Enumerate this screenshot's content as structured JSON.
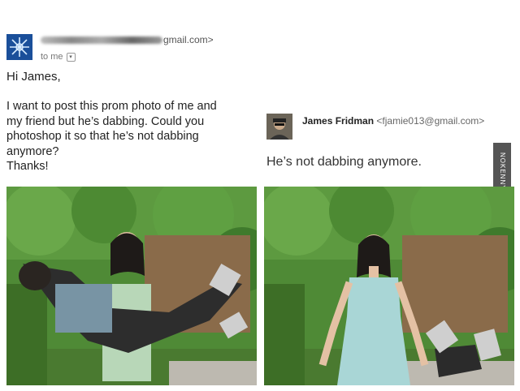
{
  "original_email": {
    "sender_suffix": "gmail.com>",
    "to_label": "to me",
    "greeting": "Hi James,",
    "body_lines": [
      "I want to post this prom photo of me and",
      "my friend but he’s dabbing. Could you",
      "photoshop it so that he’s not dabbing",
      "anymore?",
      "Thanks!"
    ]
  },
  "reply": {
    "sender_name": "James Fridman",
    "sender_email": "<fjamie013@gmail.com>",
    "body": "He’s not dabbing anymore."
  },
  "watermark": "NOKENNY",
  "colors": {
    "avatar_blue": "#1e5aa8",
    "foliage": "#3f7a2c",
    "dress_blue": "#a9d6d6"
  },
  "icons": {
    "dropdown": "chevron-down-icon",
    "avatar_left": "snowflake-avatar-icon",
    "avatar_right": "person-avatar-icon"
  }
}
